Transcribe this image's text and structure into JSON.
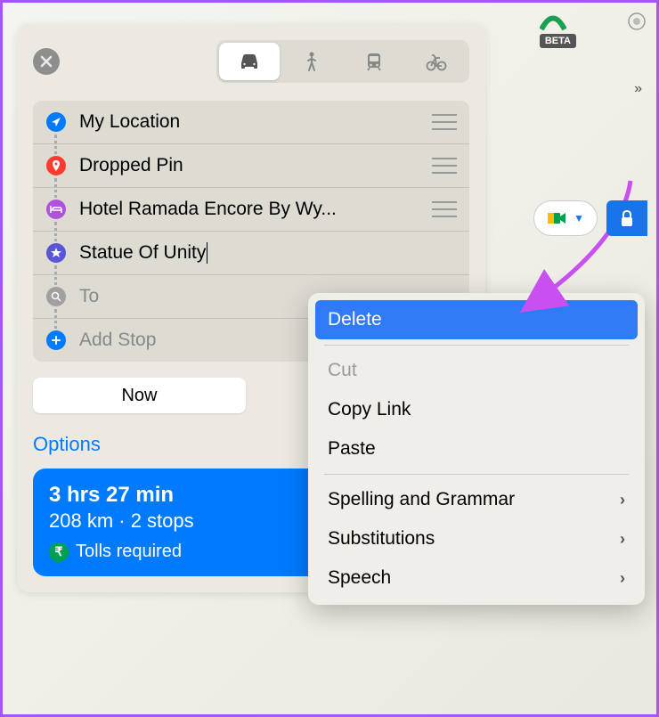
{
  "transport_modes": [
    "car",
    "walk",
    "transit",
    "bike"
  ],
  "active_mode": "car",
  "stops": [
    {
      "icon": "location",
      "label": "My Location",
      "placeholder": false,
      "draggable": true,
      "color": "#007aff"
    },
    {
      "icon": "pin",
      "label": "Dropped Pin",
      "placeholder": false,
      "draggable": true,
      "color": "#ff3b30"
    },
    {
      "icon": "hotel",
      "label": "Hotel Ramada Encore By Wy...",
      "placeholder": false,
      "draggable": true,
      "color": "#af52de"
    },
    {
      "icon": "star",
      "label": "Statue Of Unity",
      "placeholder": false,
      "draggable": true,
      "color": "#5856d6",
      "editing": true
    },
    {
      "icon": "search",
      "label": "To",
      "placeholder": true,
      "draggable": false,
      "color": "#a0a0a0"
    },
    {
      "icon": "plus",
      "label": "Add Stop",
      "placeholder": true,
      "draggable": false,
      "color": "#007aff"
    }
  ],
  "timing_button": "Now",
  "options_label": "Options",
  "route": {
    "time": "3 hrs 27 min",
    "distance": "208 km · 2 stops",
    "tolls": "Tolls required",
    "currency_symbol": "₹"
  },
  "context_menu": [
    {
      "label": "Delete",
      "highlight": true,
      "disabled": false,
      "submenu": false
    },
    {
      "divider": true
    },
    {
      "label": "Cut",
      "highlight": false,
      "disabled": true,
      "submenu": false
    },
    {
      "label": "Copy Link",
      "highlight": false,
      "disabled": false,
      "submenu": false
    },
    {
      "label": "Paste",
      "highlight": false,
      "disabled": false,
      "submenu": false
    },
    {
      "divider": true
    },
    {
      "label": "Spelling and Grammar",
      "highlight": false,
      "disabled": false,
      "submenu": true
    },
    {
      "label": "Substitutions",
      "highlight": false,
      "disabled": false,
      "submenu": true
    },
    {
      "label": "Speech",
      "highlight": false,
      "disabled": false,
      "submenu": true
    }
  ],
  "beta_label": "BETA"
}
